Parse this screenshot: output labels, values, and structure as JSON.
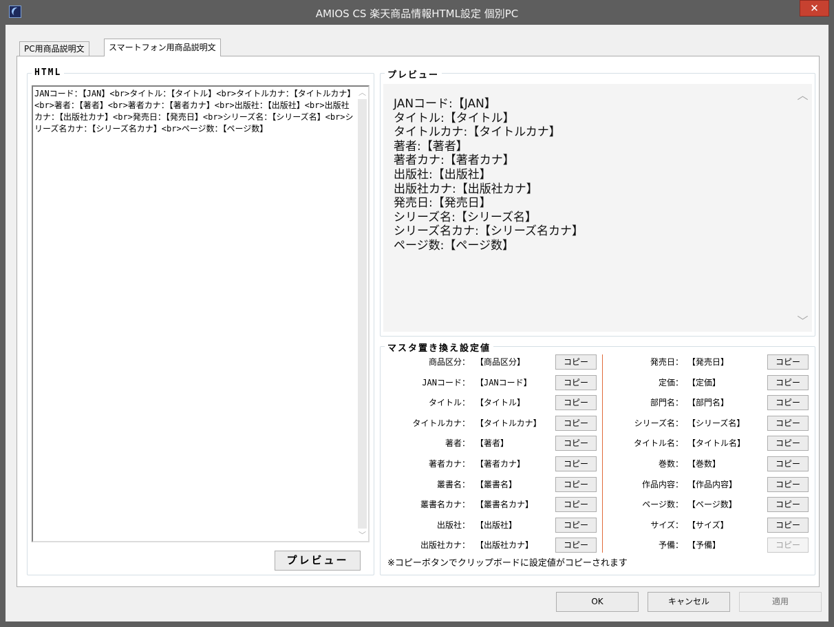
{
  "window": {
    "title": "AMIOS CS 楽天商品情報HTML設定 個別PC",
    "close_label": "✕"
  },
  "tabs": [
    {
      "label": "PC用商品説明文",
      "active": false
    },
    {
      "label": "スマートフォン用商品説明文",
      "active": true
    }
  ],
  "html_section": {
    "legend": "HTML",
    "content": "JANコード：【JAN】<br>タイトル：【タイトル】<br>タイトルカナ：【タイトルカナ】<br>著者：【著者】<br>著者カナ：【著者カナ】<br>出版社：【出版社】<br>出版社カナ：【出版社カナ】<br>発売日：【発売日】<br>シリーズ名：【シリーズ名】<br>シリーズ名カナ：【シリーズ名カナ】<br>ページ数：【ページ数】",
    "preview_button": "プレビュー"
  },
  "preview_section": {
    "legend": "プレビュー",
    "lines": [
      "JANコード:【JAN】",
      "タイトル:【タイトル】",
      "タイトルカナ:【タイトルカナ】",
      "著者:【著者】",
      "著者カナ:【著者カナ】",
      "出版社:【出版社】",
      "出版社カナ:【出版社カナ】",
      "発売日:【発売日】",
      "シリーズ名:【シリーズ名】",
      "シリーズ名カナ:【シリーズ名カナ】",
      "ページ数:【ページ数】"
    ]
  },
  "master_section": {
    "legend": "マスタ置き換え設定値",
    "copy_label": "コピー",
    "left": [
      {
        "key": "商品区分：",
        "value": "【商品区分】"
      },
      {
        "key": "JANコード：",
        "value": "【JANコード】"
      },
      {
        "key": "タイトル：",
        "value": "【タイトル】"
      },
      {
        "key": "タイトルカナ：",
        "value": "【タイトルカナ】"
      },
      {
        "key": "著者：",
        "value": "【著者】"
      },
      {
        "key": "著者カナ：",
        "value": "【著者カナ】"
      },
      {
        "key": "叢書名：",
        "value": "【叢書名】"
      },
      {
        "key": "叢書名カナ：",
        "value": "【叢書名カナ】"
      },
      {
        "key": "出版社：",
        "value": "【出版社】"
      },
      {
        "key": "出版社カナ：",
        "value": "【出版社カナ】"
      }
    ],
    "right": [
      {
        "key": "発売日：",
        "value": "【発売日】",
        "enabled": true
      },
      {
        "key": "定価：",
        "value": "【定価】",
        "enabled": true
      },
      {
        "key": "部門名：",
        "value": "【部門名】",
        "enabled": true
      },
      {
        "key": "シリーズ名：",
        "value": "【シリーズ名】",
        "enabled": true
      },
      {
        "key": "タイトル名：",
        "value": "【タイトル名】",
        "enabled": true
      },
      {
        "key": "巻数：",
        "value": "【巻数】",
        "enabled": true
      },
      {
        "key": "作品内容：",
        "value": "【作品内容】",
        "enabled": true
      },
      {
        "key": "ページ数：",
        "value": "【ページ数】",
        "enabled": true
      },
      {
        "key": "サイズ：",
        "value": "【サイズ】",
        "enabled": true
      },
      {
        "key": "予備：",
        "value": "【予備】",
        "enabled": false
      }
    ],
    "note": "※コピーボタンでクリップボードに設定値がコピーされます"
  },
  "footer": {
    "ok": "OK",
    "cancel": "キャンセル",
    "apply": "適用"
  },
  "colors": {
    "titlebar": "#5e5e5e",
    "close": "#c74130",
    "divider": "#e06a3a"
  }
}
